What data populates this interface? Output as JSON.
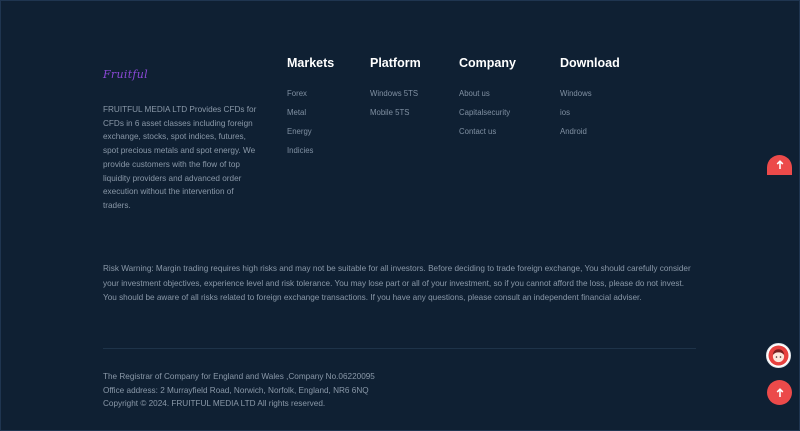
{
  "brand": {
    "logo_text": "Fruitful",
    "logo_color": "#8a48d6",
    "description": "FRUITFUL MEDIA LTD Provides CFDs for CFDs in 6 asset classes including foreign exchange, stocks, spot indices, futures, spot precious metals and spot energy. We provide customers with the flow of top liquidity providers and advanced order execution without the intervention of traders."
  },
  "columns": {
    "markets": {
      "title": "Markets",
      "links": [
        "Forex",
        "Metal",
        "Energy",
        "Indicies"
      ]
    },
    "platform": {
      "title": "Platform",
      "links": [
        "Windows 5TS",
        "Mobile 5TS"
      ]
    },
    "company": {
      "title": "Company",
      "links": [
        "About us",
        "Capitalsecurity",
        "Contact us"
      ]
    },
    "download": {
      "title": "Download",
      "links": [
        "Windows",
        "ios",
        "Android"
      ]
    }
  },
  "risk_warning": "Risk Warning: Margin trading requires high risks and may not be suitable for all investors. Before deciding to trade foreign exchange, You should carefully consider your investment objectives, experience level and risk tolerance. You may lose part or all of your investment, so if you cannot afford the loss, please do not invest. You should be aware of all risks related to foreign exchange transactions. If you have any questions, please consult an independent financial adviser.",
  "legal": {
    "registrar": "The Registrar of Company for England and Wales ,Company No.06220095",
    "address": "Office address: 2 Murrayfield Road, Norwich, Norfolk, England, NR6 6NQ",
    "copyright": "Copyright © 2024. FRUITFUL MEDIA LTD All rights reserved."
  },
  "floating": {
    "accent_color": "#ec4a4a",
    "scroll_top_icon": "arrow-up-icon",
    "support_icon": "customer-support-avatar-icon"
  },
  "colors": {
    "background": "#0f2033",
    "heading": "#ffffff",
    "text": "#8a98a8"
  }
}
